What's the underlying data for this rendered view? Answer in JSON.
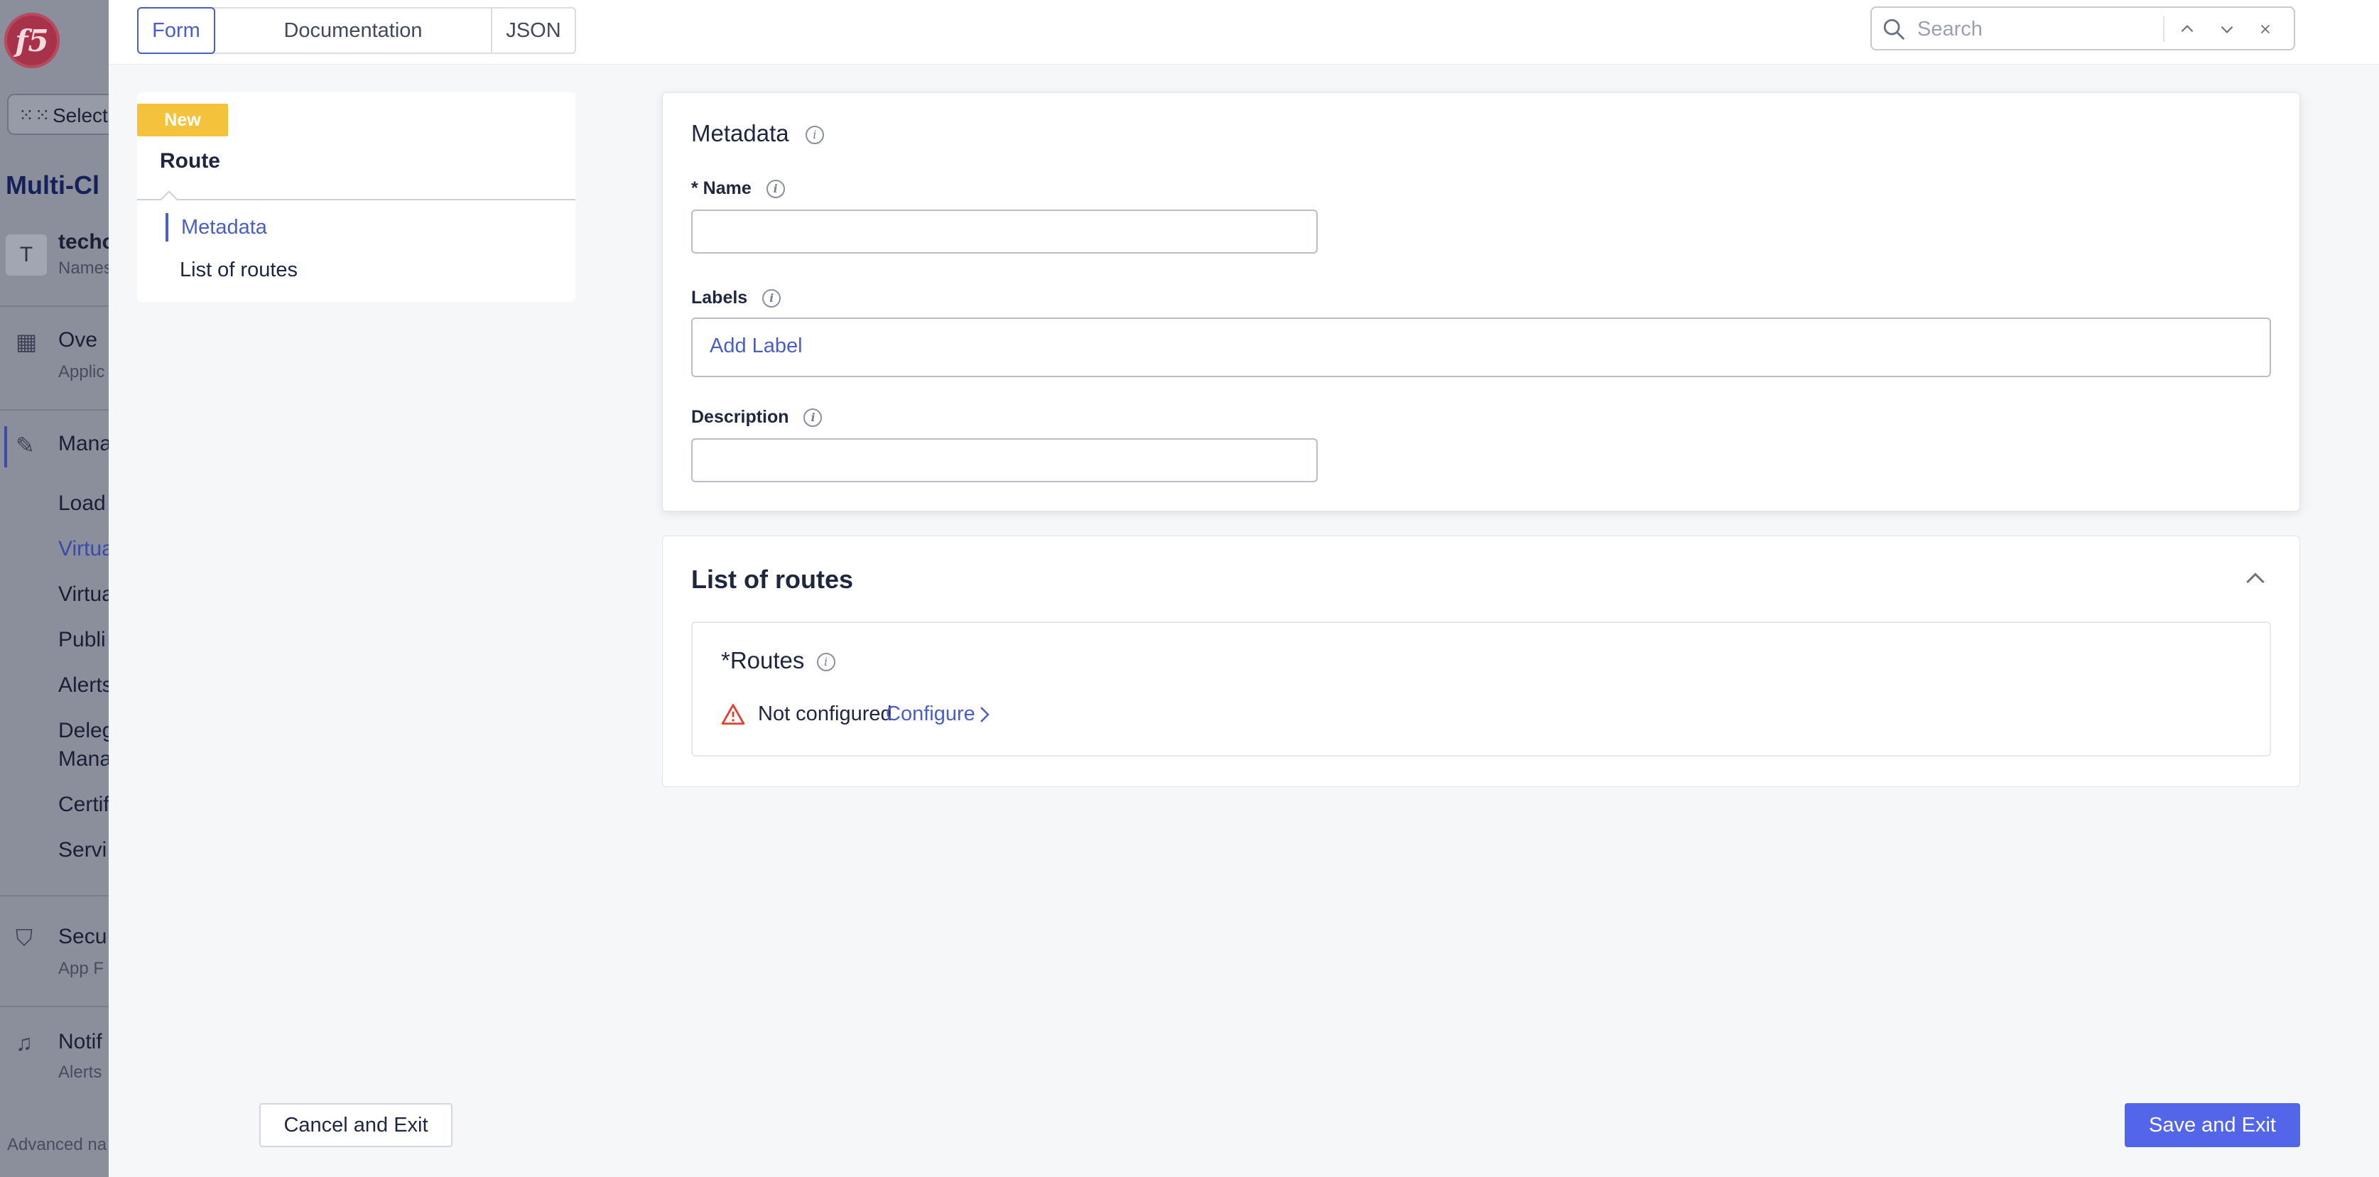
{
  "background_sidebar": {
    "select_label": "Select",
    "title": "Multi-Cl",
    "namespace_name": "techo",
    "namespace_sub": "Names",
    "avatar_letter": "T",
    "overview": "Ove",
    "overview_sub": "Applic",
    "manage": "Mana",
    "items": [
      "Load",
      "Virtua",
      "Virtua",
      "Publi",
      "Alerts",
      "Deleg",
      "Mana",
      "Certif",
      "Servi"
    ],
    "security": "Secu",
    "security_sub": "App F",
    "notifications": "Notif",
    "notifications_sub": "Alerts",
    "advanced": "Advanced na"
  },
  "tabs": {
    "form": "Form",
    "documentation": "Documentation",
    "json": "JSON"
  },
  "search": {
    "placeholder": "Search"
  },
  "nav": {
    "badge": "New",
    "title": "Route",
    "items": [
      "Metadata",
      "List of routes"
    ]
  },
  "metadata": {
    "title": "Metadata",
    "name_label": "* Name",
    "name_value": "",
    "labels_label": "Labels",
    "add_label": "Add Label",
    "description_label": "Description",
    "description_value": ""
  },
  "routes": {
    "title": "List of routes",
    "field_label": "Routes",
    "required_mark": "*",
    "status": "Not configured",
    "configure": "Configure"
  },
  "footer": {
    "cancel": "Cancel and Exit",
    "save": "Save and Exit"
  },
  "colors": {
    "accent": "#4b5ec8",
    "primary_button": "#5365e8",
    "badge": "#f5c23b",
    "warning": "#e0412f"
  }
}
